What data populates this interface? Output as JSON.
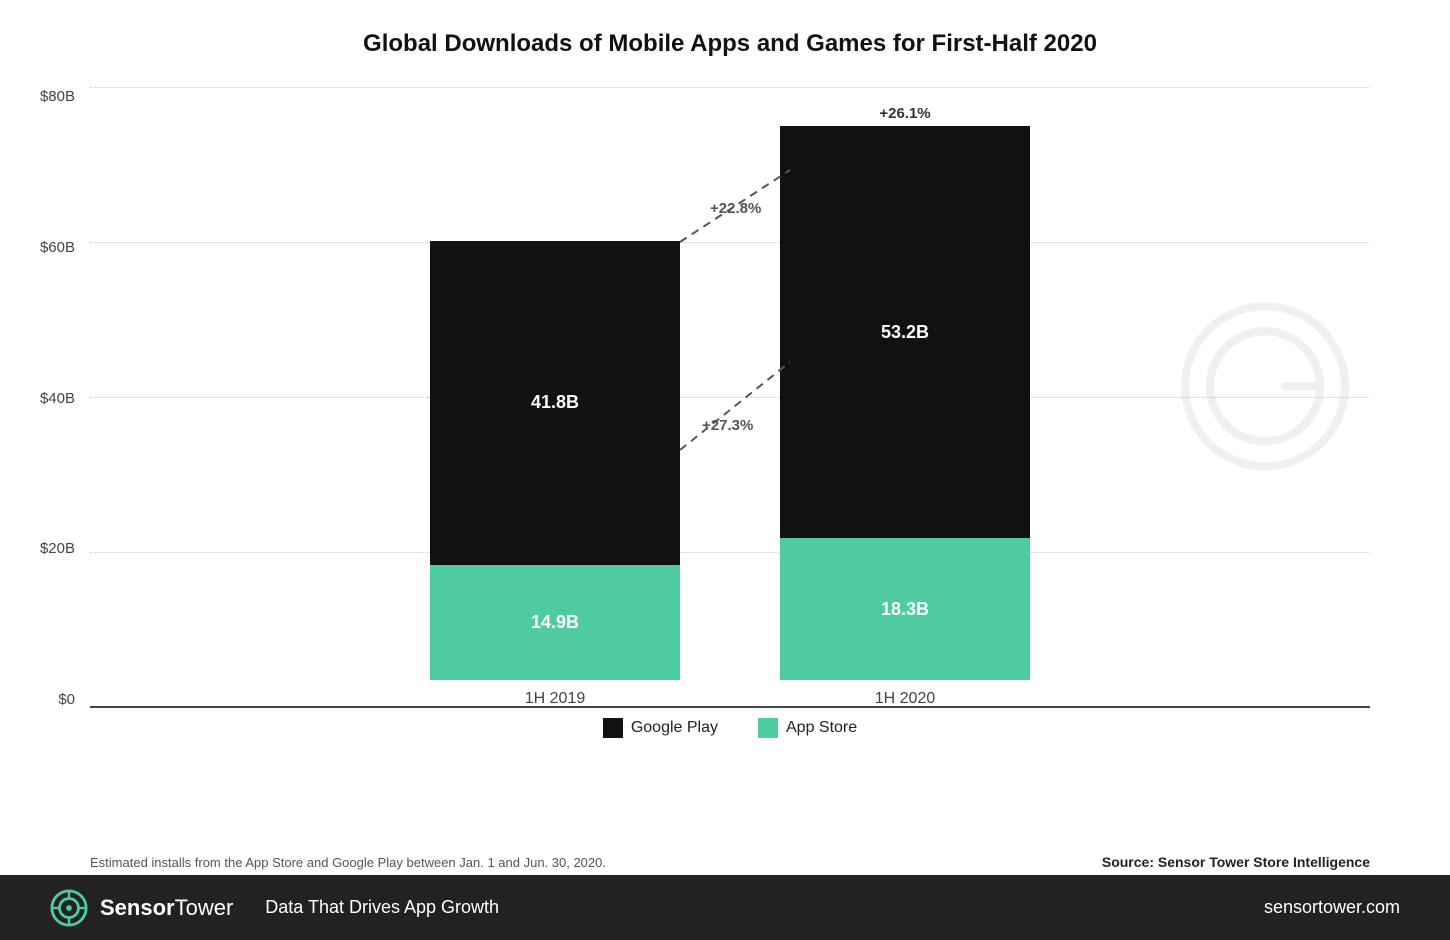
{
  "chart": {
    "title": "Global Downloads of Mobile Apps and Games for First-Half 2020",
    "y_axis_labels": [
      "$0",
      "$20B",
      "$40B",
      "$60B",
      "$80B"
    ],
    "bars": [
      {
        "period": "1H 2019",
        "google_play": {
          "value": 41.8,
          "label": "41.8B"
        },
        "app_store": {
          "value": 14.9,
          "label": "14.9B"
        },
        "total": 56.7
      },
      {
        "period": "1H 2020",
        "google_play": {
          "value": 53.2,
          "label": "53.2B"
        },
        "app_store": {
          "value": 18.3,
          "label": "18.3B"
        },
        "total": 71.5,
        "growth_total": "+26.1%"
      }
    ],
    "connector_labels": {
      "top": "+22.8%",
      "bottom": "+27.3%"
    },
    "max_value": 80
  },
  "legend": {
    "items": [
      {
        "key": "google_play",
        "label": "Google Play",
        "color": "#111111"
      },
      {
        "key": "app_store",
        "label": "App Store",
        "color": "#4ecba0"
      }
    ]
  },
  "footnote": {
    "note": "Estimated installs from the App Store and Google Play between Jan. 1 and Jun. 30, 2020.",
    "source": "Source: Sensor Tower Store Intelligence"
  },
  "watermark": {
    "text": "SensorTower"
  },
  "footer": {
    "brand_first": "Sensor",
    "brand_second": "Tower",
    "tagline": "Data That Drives App Growth",
    "website": "sensortower.com"
  }
}
